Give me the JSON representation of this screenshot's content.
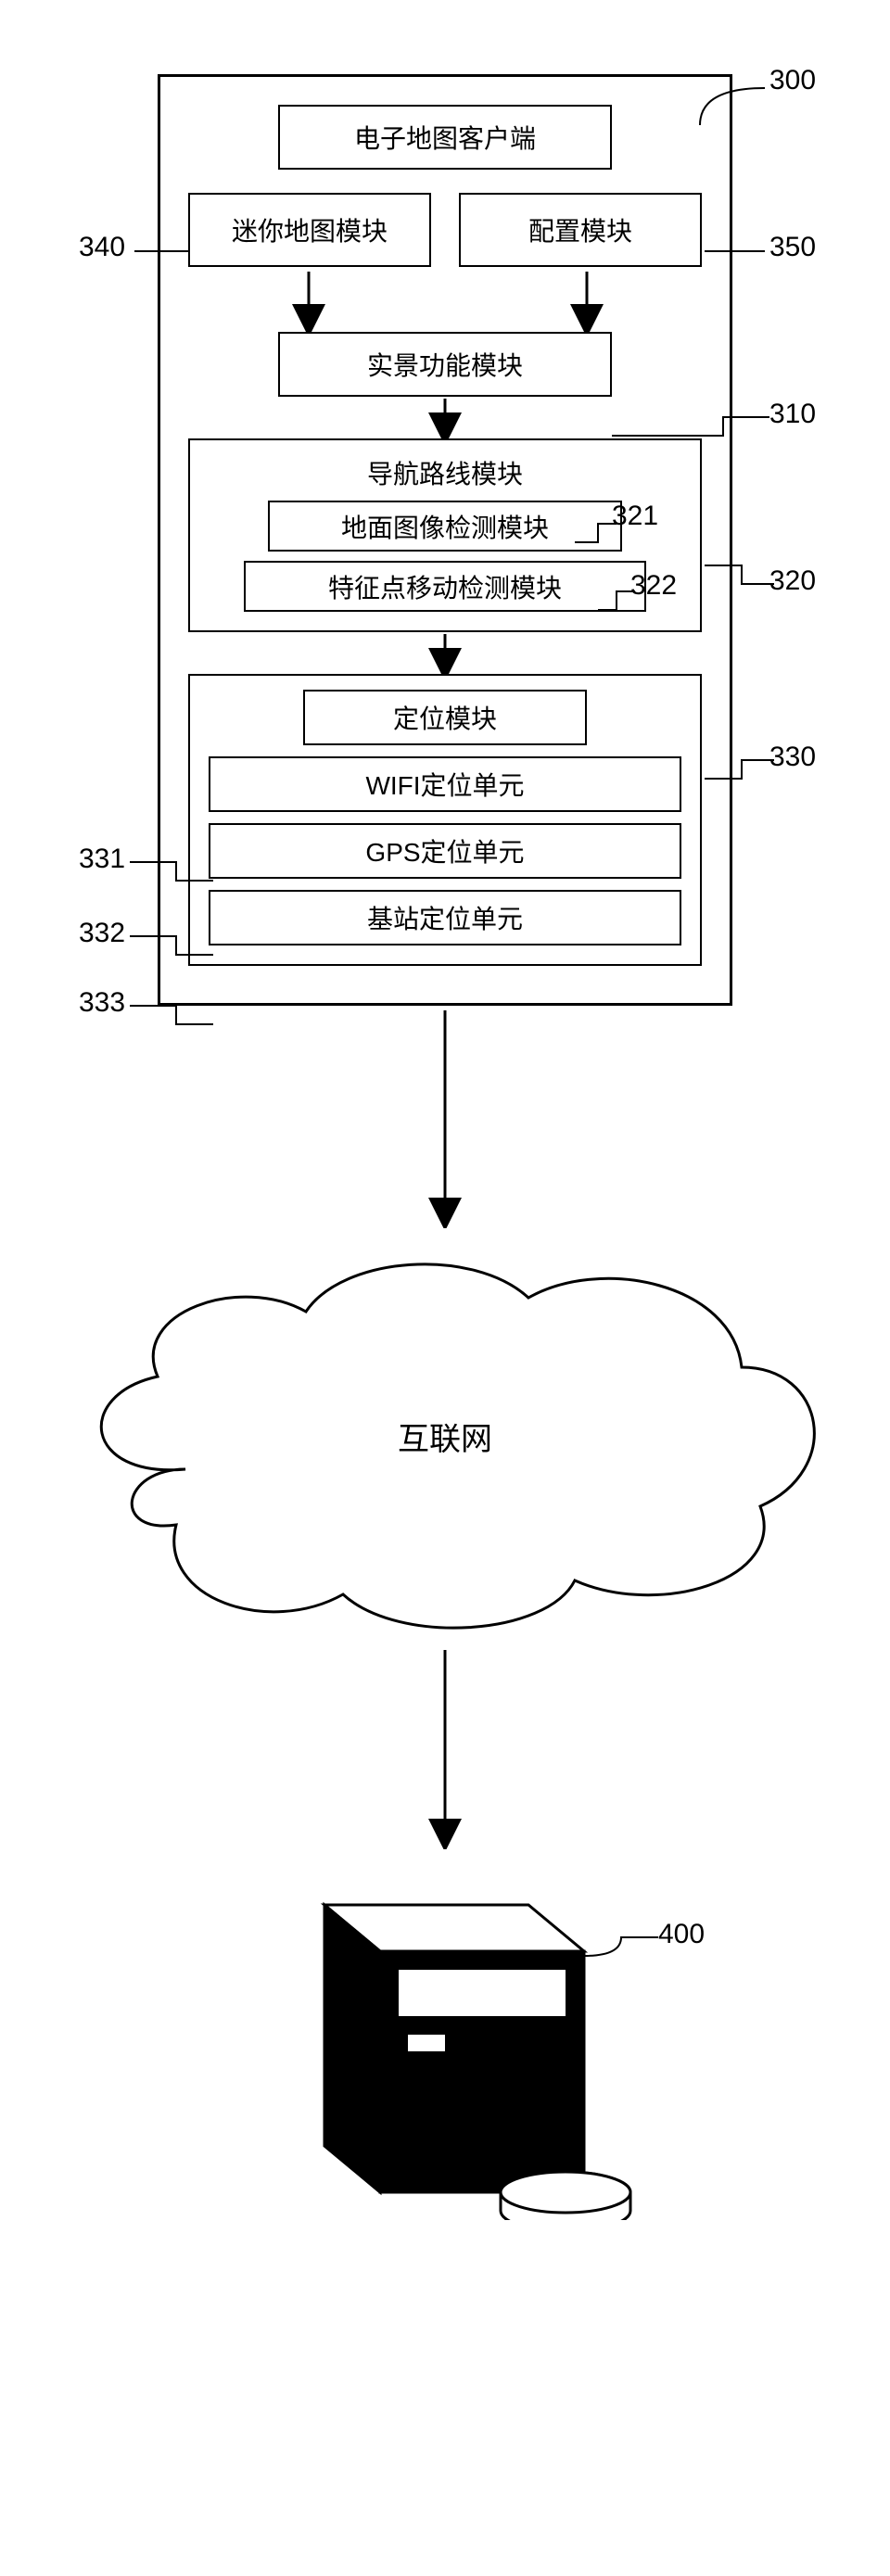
{
  "labels": {
    "n300": "300",
    "n340": "340",
    "n350": "350",
    "n310": "310",
    "n320": "320",
    "n321": "321",
    "n322": "322",
    "n330": "330",
    "n331": "331",
    "n332": "332",
    "n333": "333",
    "n400": "400"
  },
  "boxes": {
    "title": "电子地图客户端",
    "minimap": "迷你地图模块",
    "config": "配置模块",
    "realview": "实景功能模块",
    "nav_title": "导航路线模块",
    "ground_detect": "地面图像检测模块",
    "feature_detect": "特征点移动检测模块",
    "loc_title": "定位模块",
    "wifi": "WIFI定位单元",
    "gps": "GPS定位单元",
    "base": "基站定位单元"
  },
  "cloud": {
    "text": "互联网"
  }
}
